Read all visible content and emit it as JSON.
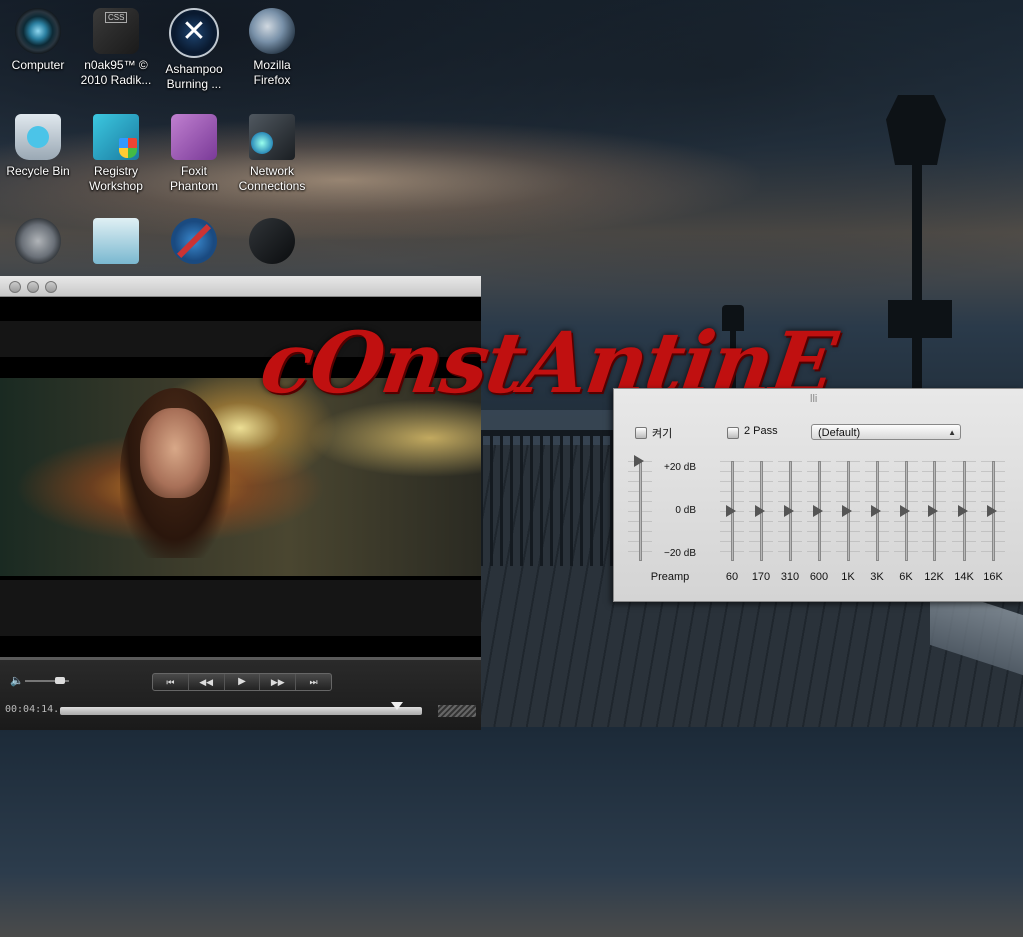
{
  "desktop": {
    "icons": [
      {
        "label": "Computer",
        "icon": "computer-icon"
      },
      {
        "label": "n0ak95™ © 2010 Radik...",
        "icon": "css-editor-icon"
      },
      {
        "label": "Ashampoo Burning ...",
        "icon": "ashampoo-icon"
      },
      {
        "label": "Mozilla Firefox",
        "icon": "firefox-icon"
      },
      {
        "label": "Recycle Bin",
        "icon": "recycle-bin-icon"
      },
      {
        "label": "Registry Workshop",
        "icon": "registry-workshop-icon"
      },
      {
        "label": "Foxit Phantom",
        "icon": "foxit-icon"
      },
      {
        "label": "Network Connections",
        "icon": "network-connections-icon"
      },
      {
        "label": "",
        "icon": "admin-tools-icon"
      },
      {
        "label": "",
        "icon": "registry-image-icon"
      },
      {
        "label": "",
        "icon": "windows-tools-icon"
      },
      {
        "label": "",
        "icon": "control-panel-icon"
      }
    ]
  },
  "overlay_text": "cOnstAntinE",
  "player": {
    "timecode": "00:04:14...",
    "transport": {
      "skip_back": "⏮",
      "rewind": "◀◀",
      "play": "▶",
      "forward": "▶▶",
      "skip_forward": "⏭"
    },
    "volume_symbol": "🔈",
    "seek_fraction": 0.93,
    "volume_fraction": 0.8
  },
  "equalizer": {
    "title": "lli",
    "enable_label": "켜기",
    "enable_checked": false,
    "two_pass_label": "2 Pass",
    "two_pass_checked": false,
    "preset": "(Default)",
    "db_top": "+20 dB",
    "db_mid": "0 dB",
    "db_bot": "−20 dB",
    "preamp": {
      "label": "Preamp",
      "value_db": 20
    },
    "bands": [
      {
        "label": "60",
        "value_db": 0
      },
      {
        "label": "170",
        "value_db": 0
      },
      {
        "label": "310",
        "value_db": 0
      },
      {
        "label": "600",
        "value_db": 0
      },
      {
        "label": "1K",
        "value_db": 0
      },
      {
        "label": "3K",
        "value_db": 0
      },
      {
        "label": "6K",
        "value_db": 0
      },
      {
        "label": "12K",
        "value_db": 0
      },
      {
        "label": "14K",
        "value_db": 0
      },
      {
        "label": "16K",
        "value_db": 0
      }
    ]
  },
  "colors": {
    "logo_red": "#c01010"
  }
}
